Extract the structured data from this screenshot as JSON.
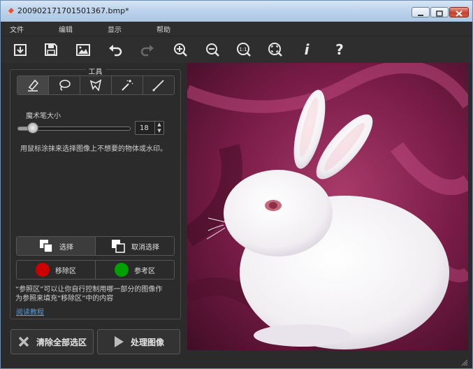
{
  "window": {
    "title": "2009021717015013​67.bmp*"
  },
  "menu": [
    "文件",
    "编辑",
    "显示",
    "帮助"
  ],
  "toolbar": {
    "icons": [
      "open-icon",
      "save-icon",
      "image-icon",
      "undo-icon",
      "redo-icon",
      "zoom-in-icon",
      "zoom-out-icon",
      "actual-size-icon",
      "fit-window-icon",
      "info-icon",
      "help-icon"
    ],
    "actual_size_label": "1:1",
    "info_label": "i",
    "help_label": "?"
  },
  "tools_panel": {
    "title": "工具",
    "brush_size_label": "魔术笔大小",
    "brush_size_value": "18",
    "brush_size_fraction": 0.1,
    "instruction": "用鼠标涂抹来选择图像上不想要的物体或水印。",
    "select_label": "选择",
    "deselect_label": "取消选择",
    "remove_area_label": "移除区",
    "reference_area_label": "参考区",
    "help_text_line1": "“参照区”可以让你自行控制用哪一部分的图像作",
    "help_text_line2": "为参照来填充“移除区”中的内容",
    "tutorial_link": "阅读教程"
  },
  "actions": {
    "clear_all": "清除全部选区",
    "process": "处理图像"
  },
  "colors": {
    "remove_area": "#cc0000",
    "reference_area": "#00a000"
  }
}
